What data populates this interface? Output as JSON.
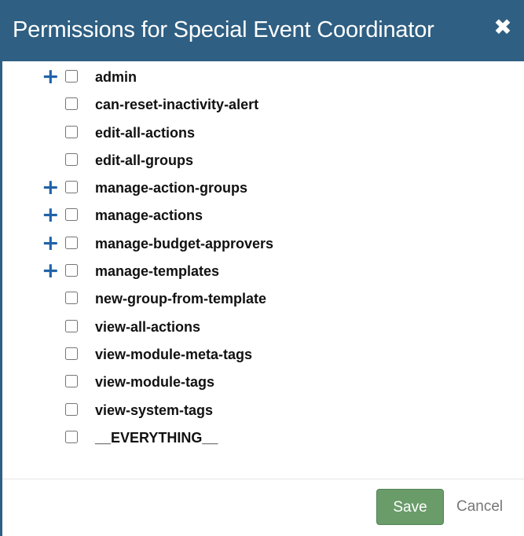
{
  "dialog": {
    "title": "Permissions for Special Event Coordinator",
    "close_icon": "close-icon",
    "colors": {
      "header": "#2f5f82",
      "expand_icon": "#1f63a8",
      "save_button": "#6a9c6a"
    }
  },
  "permissions": [
    {
      "label": "admin",
      "expandable": true,
      "checked": false
    },
    {
      "label": "can-reset-inactivity-alert",
      "expandable": false,
      "checked": false
    },
    {
      "label": "edit-all-actions",
      "expandable": false,
      "checked": false
    },
    {
      "label": "edit-all-groups",
      "expandable": false,
      "checked": false
    },
    {
      "label": "manage-action-groups",
      "expandable": true,
      "checked": false
    },
    {
      "label": "manage-actions",
      "expandable": true,
      "checked": false
    },
    {
      "label": "manage-budget-approvers",
      "expandable": true,
      "checked": false
    },
    {
      "label": "manage-templates",
      "expandable": true,
      "checked": false
    },
    {
      "label": "new-group-from-template",
      "expandable": false,
      "checked": false
    },
    {
      "label": "view-all-actions",
      "expandable": false,
      "checked": false
    },
    {
      "label": "view-module-meta-tags",
      "expandable": false,
      "checked": false
    },
    {
      "label": "view-module-tags",
      "expandable": false,
      "checked": false
    },
    {
      "label": "view-system-tags",
      "expandable": false,
      "checked": false
    },
    {
      "label": "__EVERYTHING__",
      "expandable": false,
      "checked": false
    }
  ],
  "footer": {
    "save_label": "Save",
    "cancel_label": "Cancel"
  }
}
